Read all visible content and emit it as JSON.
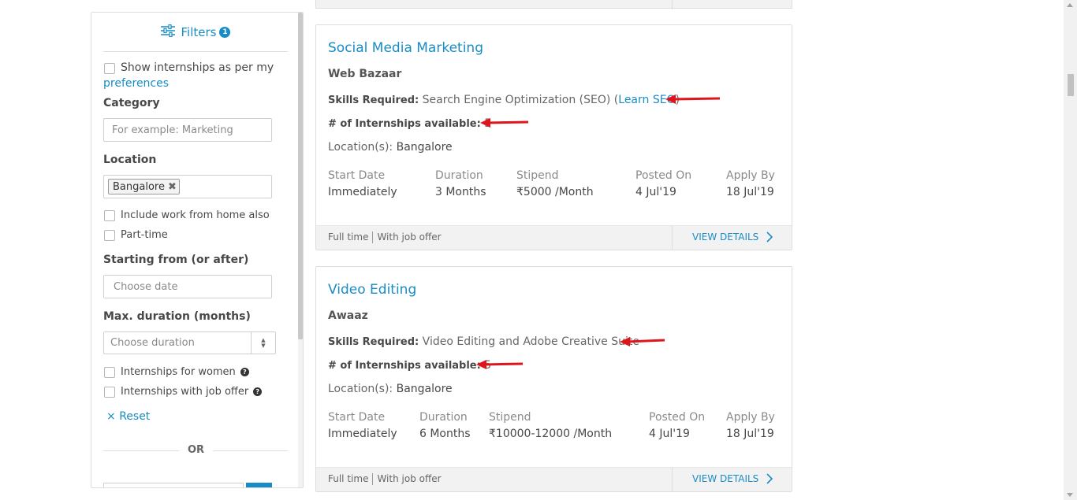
{
  "filters": {
    "title": "Filters",
    "count": "1",
    "preferences_text": "Show internships as per my",
    "preferences_link": "preferences",
    "category_label": "Category",
    "category_placeholder": "For example: Marketing",
    "location_label": "Location",
    "location_tag": "Bangalore",
    "wfh_label": "Include work from home also",
    "parttime_label": "Part-time",
    "starting_label": "Starting from (or after)",
    "starting_placeholder": "Choose date",
    "duration_label": "Max. duration (months)",
    "duration_placeholder": "Choose duration",
    "women_label": "Internships for women",
    "joboffer_label": "Internships with job offer",
    "reset_label": "Reset",
    "reset_symbol": "×",
    "or_text": "OR",
    "help_symbol": "?"
  },
  "listings": [
    {
      "title": "Social Media Marketing",
      "company": "Web Bazaar",
      "skills_label": "Skills Required:",
      "skills": "Search Engine Optimization (SEO)",
      "learn_prefix": "(",
      "learn_link": "Learn SEO",
      "learn_suffix": ")",
      "openings_label": "# of Internships available:",
      "openings": "5",
      "location_label": "Location(s):",
      "location": "Bangalore",
      "start_label": "Start Date",
      "start": "Immediately",
      "duration_label": "Duration",
      "duration": "3 Months",
      "stipend_label": "Stipend",
      "stipend": "₹5000 /Month",
      "posted_label": "Posted On",
      "posted": "4 Jul'19",
      "apply_label": "Apply By",
      "apply": "18 Jul'19",
      "tag_1": "Full time",
      "tag_2": "With job offer",
      "view_label": "VIEW DETAILS"
    },
    {
      "title": "Video Editing",
      "company": "Awaaz",
      "skills_label": "Skills Required:",
      "skills": "Video Editing and Adobe Creative Suite",
      "openings_label": "# of Internships available:",
      "openings": "5",
      "location_label": "Location(s):",
      "location": "Bangalore",
      "start_label": "Start Date",
      "start": "Immediately",
      "duration_label": "Duration",
      "duration": "6 Months",
      "stipend_label": "Stipend",
      "stipend": "₹10000-12000 /Month",
      "posted_label": "Posted On",
      "posted": "4 Jul'19",
      "apply_label": "Apply By",
      "apply": "18 Jul'19",
      "tag_1": "Full time",
      "tag_2": "With job offer",
      "view_label": "VIEW DETAILS"
    }
  ],
  "colors": {
    "accent": "#1a8cc5",
    "annotation_arrow": "#e0151b"
  }
}
